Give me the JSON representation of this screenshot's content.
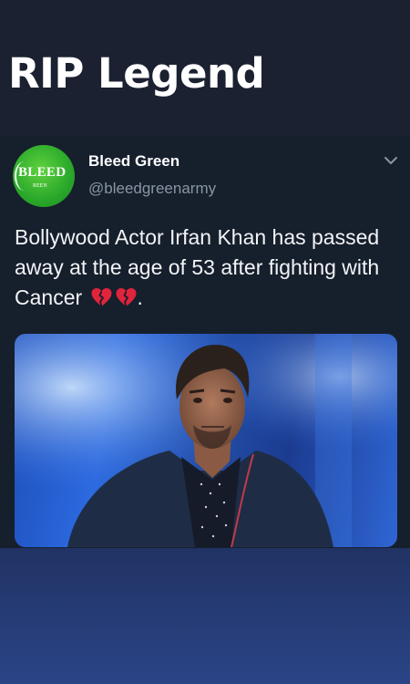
{
  "headline": "RIP Legend",
  "tweet": {
    "author_name": "Bleed Green",
    "author_handle": "@bleedgreenarmy",
    "avatar": {
      "logo_text": "BLEED",
      "logo_subtext": "REEN",
      "color": "#2aa82a"
    },
    "text": "Bollywood Actor Irfan Khan has passed away at the age of 53 after fighting with Cancer",
    "text_suffix": ".",
    "emojis": [
      "broken-heart-icon",
      "broken-heart-icon"
    ],
    "menu_icon": "chevron-down-icon"
  },
  "colors": {
    "background": "#1b2130",
    "tweet_background": "#161f2c",
    "handle": "#8a95a3",
    "accent_red": "#e0243c"
  }
}
